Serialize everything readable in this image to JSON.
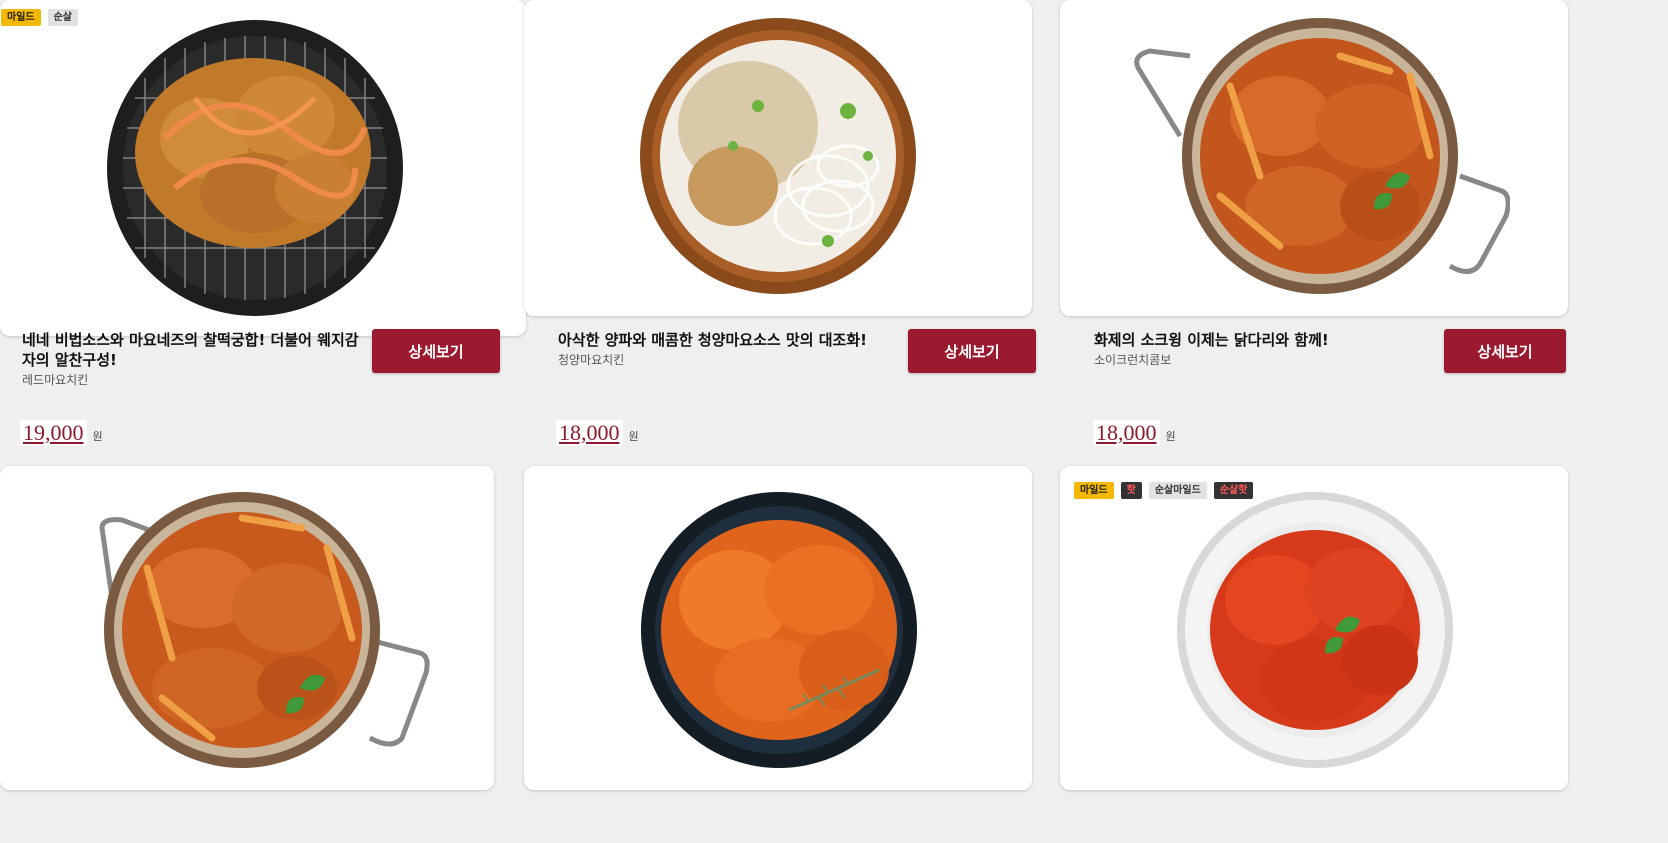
{
  "products": [
    {
      "badges": [
        {
          "label": "마일드",
          "style": "yellow"
        },
        {
          "label": "순살",
          "style": "gray"
        }
      ],
      "description": "네네 비법소스와 마요네즈의 찰떡궁합! 더불어 웨지감자의 알찬구성!",
      "name": "레드마요치킨",
      "button": "상세보기",
      "price": "19,000",
      "unit": "원",
      "plate": "black-grill"
    },
    {
      "badges": [],
      "description": "아삭한 양파와 매콤한 청양마요소스 맛의 대조화!",
      "name": "청양마요치킨",
      "button": "상세보기",
      "price": "18,000",
      "unit": "원",
      "plate": "wood-onion"
    },
    {
      "badges": [],
      "description": "화제의 소크윙 이제는 닭다리와 함께!",
      "name": "소이크런치콤보",
      "button": "상세보기",
      "price": "18,000",
      "unit": "원",
      "plate": "steel-pan"
    },
    {
      "badges": [],
      "plate": "steel-pan-left"
    },
    {
      "badges": [],
      "plate": "dark-fried"
    },
    {
      "badges": [
        {
          "label": "마일드",
          "style": "yellow"
        },
        {
          "label": "핫",
          "style": "dark-red"
        },
        {
          "label": "순살마일드",
          "style": "gray"
        },
        {
          "label": "순살핫",
          "style": "dark-red"
        }
      ],
      "plate": "white-red"
    }
  ]
}
